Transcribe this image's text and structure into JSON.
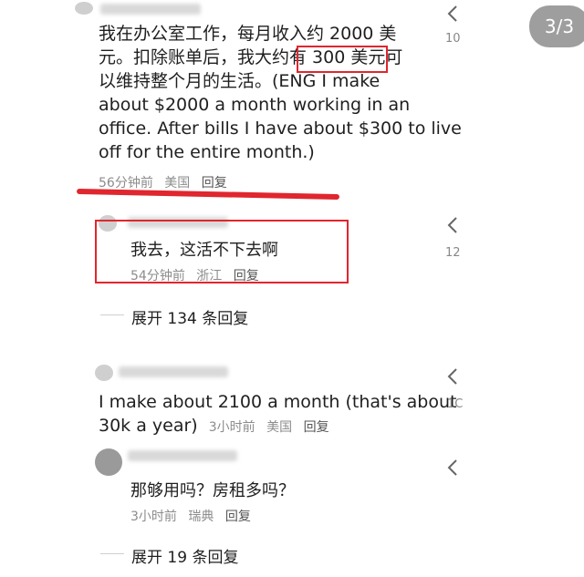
{
  "page_indicator": "3/3",
  "comments": [
    {
      "text_lines": [
        "我在办公室工作，每月收入约 2000 美",
        "元。扣除账单后，我大约有 300 美元可",
        "以维持整个月的生活。(ENG I make",
        "about $2000 a month working in an",
        "office. After bills I have about $300 to live",
        "off for the entire month.)"
      ],
      "time": "56分钟前",
      "location": "美国",
      "reply": "回复",
      "like_count": "10"
    },
    {
      "text": "我去，这活不下去啊",
      "time": "54分钟前",
      "location": "浙江",
      "reply": "回复",
      "like_count": "12"
    },
    {
      "expand": "展开 134 条回复"
    },
    {
      "text_lines": [
        "I make about 2100 a month (that's about",
        "30k a year)"
      ],
      "time": "3小时前",
      "location": "美国",
      "reply": "回复",
      "like_count": "1C"
    },
    {
      "text": "那够用吗？房租多吗？",
      "time": "3小时前",
      "location": "瑞典",
      "reply": "回复"
    },
    {
      "expand": "展开 19 条回复"
    }
  ],
  "colors": {
    "highlight": "#e0262e",
    "meta": "#8c8c8c",
    "pill": "#9e9e9e"
  },
  "icons": [
    "like-icon"
  ]
}
